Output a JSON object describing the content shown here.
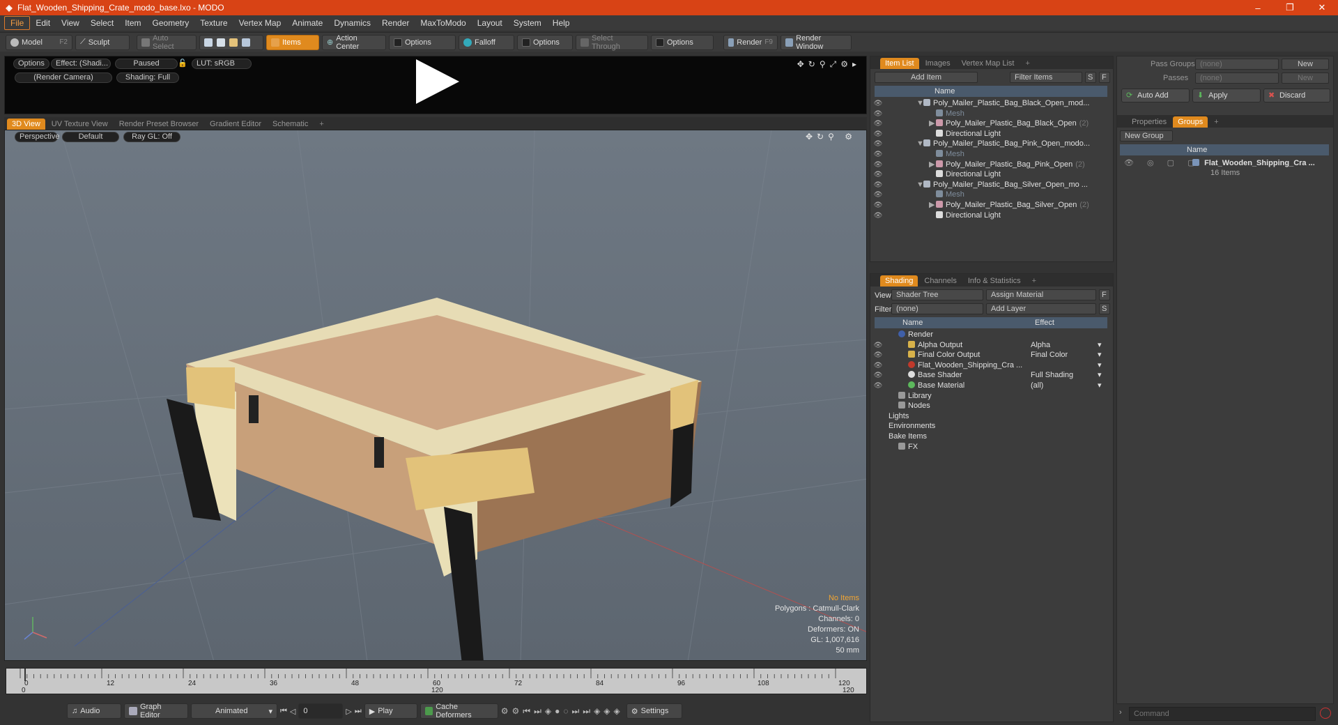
{
  "window": {
    "title": "Flat_Wooden_Shipping_Crate_modo_base.lxo - MODO",
    "minimize": "–",
    "restore": "❐",
    "close": "✕"
  },
  "menu": [
    "File",
    "Edit",
    "View",
    "Select",
    "Item",
    "Geometry",
    "Texture",
    "Vertex Map",
    "Animate",
    "Dynamics",
    "Render",
    "MaxToModo",
    "Layout",
    "System",
    "Help"
  ],
  "toolbar": {
    "model": "Model",
    "model_key": "F2",
    "sculpt": "Sculpt",
    "auto_select": "Auto Select",
    "items": "Items",
    "action_center": "Action Center",
    "options1": "Options",
    "falloff": "Falloff",
    "options2": "Options",
    "select_through": "Select Through",
    "options3": "Options",
    "render": "Render",
    "render_key": "F9",
    "render_window": "Render Window"
  },
  "preview": {
    "options": "Options",
    "effect": "Effect: (Shadi...",
    "paused": "Paused",
    "lut": "LUT: sRGB",
    "camera": "(Render Camera)",
    "shading": "Shading: Full"
  },
  "viewport_tabs": [
    "3D View",
    "UV Texture View",
    "Render Preset Browser",
    "Gradient Editor",
    "Schematic",
    "+"
  ],
  "viewport": {
    "perspective": "Perspective",
    "default": "Default",
    "raygl": "Ray GL: Off",
    "info": {
      "no_items": "No Items",
      "polygons": "Polygons : Catmull-Clark",
      "channels": "Channels: 0",
      "deformers": "Deformers: ON",
      "gl": "GL: 1,007,616",
      "mm": "50 mm"
    }
  },
  "timeline": {
    "ticks": [
      "0",
      "12",
      "24",
      "36",
      "48",
      "60",
      "72",
      "84",
      "96",
      "108",
      "120"
    ],
    "start": "0",
    "mid": "120",
    "end": "120"
  },
  "transport": {
    "audio": "Audio",
    "graph_editor": "Graph Editor",
    "animated": "Animated",
    "frame": "0",
    "play": "Play",
    "cache_deformers": "Cache Deformers",
    "settings": "Settings"
  },
  "item_list": {
    "tabs": [
      "Item List",
      "Images",
      "Vertex Map List",
      "+"
    ],
    "add_item": "Add Item",
    "filter_items": "Filter Items",
    "s": "S",
    "f": "F",
    "name_col": "Name",
    "rows": [
      {
        "label": "Poly_Mailer_Plastic_Bag_Black_Open_mod...",
        "indent": 0,
        "kind": "scene",
        "arrow": "▼"
      },
      {
        "label": "Mesh",
        "indent": 1,
        "kind": "mesh",
        "arrow": ""
      },
      {
        "label": "Poly_Mailer_Plastic_Bag_Black_Open",
        "count": "(2)",
        "indent": 1,
        "kind": "group",
        "arrow": "▶"
      },
      {
        "label": "Directional Light",
        "indent": 1,
        "kind": "light",
        "arrow": ""
      },
      {
        "label": "Poly_Mailer_Plastic_Bag_Pink_Open_modo...",
        "indent": 0,
        "kind": "scene",
        "arrow": "▼"
      },
      {
        "label": "Mesh",
        "indent": 1,
        "kind": "mesh",
        "arrow": ""
      },
      {
        "label": "Poly_Mailer_Plastic_Bag_Pink_Open",
        "count": "(2)",
        "indent": 1,
        "kind": "group",
        "arrow": "▶"
      },
      {
        "label": "Directional Light",
        "indent": 1,
        "kind": "light",
        "arrow": ""
      },
      {
        "label": "Poly_Mailer_Plastic_Bag_Silver_Open_mo ...",
        "indent": 0,
        "kind": "scene",
        "arrow": "▼"
      },
      {
        "label": "Mesh",
        "indent": 1,
        "kind": "mesh",
        "arrow": ""
      },
      {
        "label": "Poly_Mailer_Plastic_Bag_Silver_Open",
        "count": "(2)",
        "indent": 1,
        "kind": "group",
        "arrow": "▶"
      },
      {
        "label": "Directional Light",
        "indent": 1,
        "kind": "light",
        "arrow": ""
      }
    ]
  },
  "shading": {
    "tabs": [
      "Shading",
      "Channels",
      "Info & Statistics",
      "+"
    ],
    "view_label": "View",
    "view_value": "Shader Tree",
    "assign_material": "Assign Material",
    "f": "F",
    "filter_label": "Filter",
    "filter_value": "(none)",
    "add_layer": "Add Layer",
    "s": "S",
    "name_col": "Name",
    "effect_col": "Effect",
    "rows": [
      {
        "label": "Render",
        "effect": "",
        "indent": 0,
        "kind": "render",
        "eye": false
      },
      {
        "label": "Alpha Output",
        "effect": "Alpha",
        "indent": 1,
        "kind": "output",
        "eye": true
      },
      {
        "label": "Final Color Output",
        "effect": "Final Color",
        "indent": 1,
        "kind": "output",
        "eye": true
      },
      {
        "label": "Flat_Wooden_Shipping_Cra ...",
        "effect": "",
        "indent": 1,
        "kind": "mask",
        "eye": true
      },
      {
        "label": "Base Shader",
        "effect": "Full Shading",
        "indent": 1,
        "kind": "shader",
        "eye": true
      },
      {
        "label": "Base Material",
        "effect": "(all)",
        "indent": 1,
        "kind": "material",
        "eye": true
      },
      {
        "label": "Library",
        "effect": "",
        "indent": 0,
        "kind": "folder",
        "eye": false
      },
      {
        "label": "Nodes",
        "effect": "",
        "indent": 0,
        "kind": "folder",
        "eye": false
      },
      {
        "label": "Lights",
        "effect": "",
        "indent": -1,
        "kind": "none",
        "eye": false
      },
      {
        "label": "Environments",
        "effect": "",
        "indent": -1,
        "kind": "none",
        "eye": false
      },
      {
        "label": "Bake Items",
        "effect": "",
        "indent": -1,
        "kind": "none",
        "eye": false
      },
      {
        "label": "FX",
        "effect": "",
        "indent": 0,
        "kind": "fx",
        "eye": false
      }
    ]
  },
  "groups_panel": {
    "pass_groups_label": "Pass Groups",
    "pass_groups_value": "(none)",
    "new": "New",
    "passes_label": "Passes",
    "passes_value": "(none)",
    "new2": "New",
    "auto_add": "Auto Add",
    "apply": "Apply",
    "discard": "Discard",
    "tabs": [
      "Properties",
      "Groups",
      "+"
    ],
    "new_group": "New Group",
    "name_col": "Name",
    "group_name": "Flat_Wooden_Shipping_Cra ...",
    "group_items": "16 Items"
  },
  "command": {
    "placeholder": "Command"
  }
}
